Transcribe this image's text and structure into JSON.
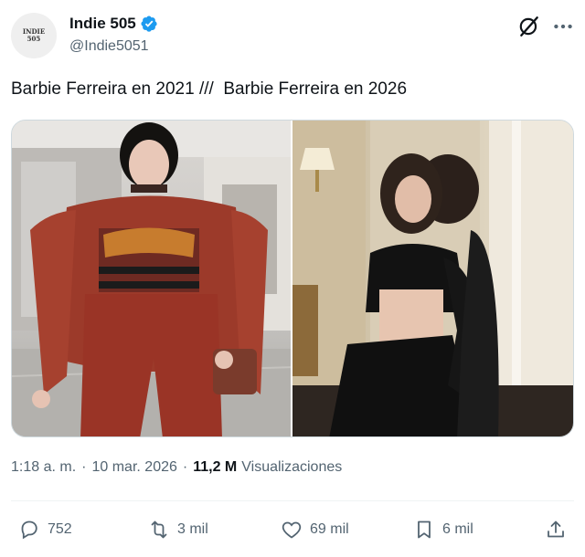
{
  "author": {
    "avatar_text_line1": "INDIE",
    "avatar_text_line2": "505",
    "display_name": "Indie 505",
    "handle": "@Indie5051",
    "verified_icon": "verified-badge-icon"
  },
  "header_icons": {
    "grok": "grok-icon",
    "more": "more-icon"
  },
  "tweet": {
    "text": "Barbie Ferreira en 2021 ///  Barbie Ferreira en 2026"
  },
  "media": {
    "images": [
      {
        "name": "barbie-2021-photo",
        "icon": "photo"
      },
      {
        "name": "barbie-2026-photo",
        "icon": "photo"
      }
    ]
  },
  "meta": {
    "time": "1:18 a. m.",
    "separator": "·",
    "date": "10 mar. 2026",
    "views_count": "11,2 M",
    "views_label": "Visualizaciones"
  },
  "actions": {
    "replies": "752",
    "reposts": "3 mil",
    "likes": "69 mil",
    "bookmarks": "6 mil"
  },
  "colors": {
    "accent": "#1d9bf0",
    "text_primary": "#0f1419",
    "text_secondary": "#536471"
  }
}
